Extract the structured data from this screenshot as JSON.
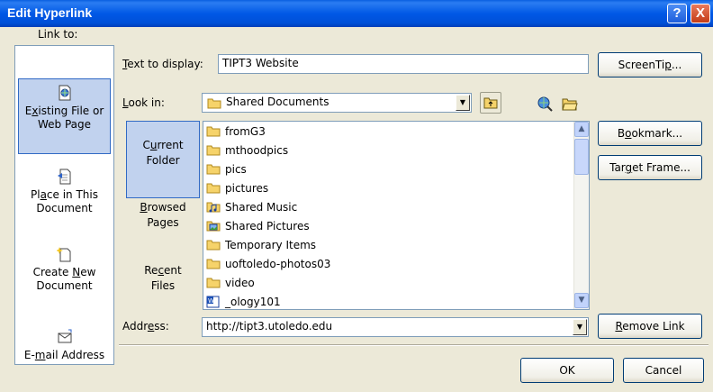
{
  "window": {
    "title": "Edit Hyperlink",
    "help_glyph": "?",
    "close_glyph": "X"
  },
  "link_to": {
    "label": "Link to:",
    "items": [
      {
        "line1_pre": "E",
        "line1_u": "x",
        "line1_post": "isting File or",
        "line2": "Web Page",
        "icon": "existing-file-icon"
      },
      {
        "line1_pre": "Pl",
        "line1_u": "a",
        "line1_post": "ce in This",
        "line2": "Document",
        "icon": "place-in-document-icon"
      },
      {
        "line1_pre": "Create ",
        "line1_u": "N",
        "line1_post": "ew",
        "line2": "Document",
        "icon": "new-document-icon"
      },
      {
        "line1_pre": "E-",
        "line1_u": "m",
        "line1_post": "ail Address",
        "line2": "",
        "icon": "email-icon"
      }
    ]
  },
  "text_to_display": {
    "label_u": "T",
    "label_rest": "ext to display:",
    "value": "TIPT3 Website"
  },
  "look_in": {
    "label_u": "L",
    "label_rest": "ook in:",
    "value": "Shared Documents"
  },
  "locations": [
    {
      "line1_pre": "C",
      "line1_u": "u",
      "line1_post": "rrent",
      "line2": "Folder"
    },
    {
      "line1_pre": "",
      "line1_u": "B",
      "line1_post": "rowsed",
      "line2": "Pages"
    },
    {
      "line1_pre": "Re",
      "line1_u": "c",
      "line1_post": "ent",
      "line2": "Files"
    }
  ],
  "files": [
    {
      "name": "fromG3",
      "icon": "folder-icon"
    },
    {
      "name": "mthoodpics",
      "icon": "folder-icon"
    },
    {
      "name": "pics",
      "icon": "folder-icon"
    },
    {
      "name": "pictures",
      "icon": "folder-icon"
    },
    {
      "name": "Shared Music",
      "icon": "music-folder-icon"
    },
    {
      "name": "Shared Pictures",
      "icon": "pictures-folder-icon"
    },
    {
      "name": "Temporary Items",
      "icon": "folder-icon"
    },
    {
      "name": "uoftoledo-photos03",
      "icon": "folder-icon"
    },
    {
      "name": "video",
      "icon": "folder-icon"
    },
    {
      "name": "_ology101",
      "icon": "word-document-icon"
    }
  ],
  "address": {
    "label_pre": "Addr",
    "label_u": "e",
    "label_post": "ss:",
    "value": "http://tipt3.utoledo.edu"
  },
  "buttons": {
    "screentip": {
      "pre": "ScreenTi",
      "u": "p",
      "post": "..."
    },
    "bookmark": {
      "pre": "B",
      "u": "o",
      "post": "okmark..."
    },
    "target_frame": {
      "pre": "Tar",
      "u": "g",
      "post": "et Frame..."
    },
    "remove_link": {
      "pre": "",
      "u": "R",
      "post": "emove Link"
    },
    "ok": "OK",
    "cancel": "Cancel"
  },
  "colors": {
    "titlebar": "#0058e6",
    "selection": "#c1d2ee",
    "dialog_bg": "#ece9d8"
  }
}
